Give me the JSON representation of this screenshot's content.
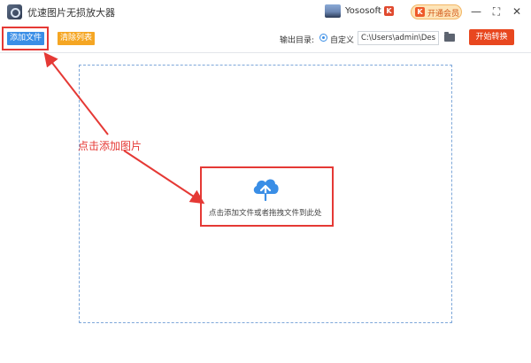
{
  "window": {
    "title": "优速图片无损放大器",
    "user_name": "Yososoft",
    "user_chevron": "⌵",
    "brand_badge": "K",
    "vip_icon": "K",
    "vip_label": "开通会员",
    "min_glyph": "—",
    "max_glyph": "⛶",
    "close_glyph": "✕"
  },
  "toolbar": {
    "add_file_label": "添加文件",
    "clear_list_label": "清除列表",
    "output_dir_label": "输出目录:",
    "custom_label": "自定义",
    "output_path_value": "C:\\Users\\admin\\Deskto",
    "start_label": "开始转换"
  },
  "drop_zone": {
    "hint": "点击添加文件或者拖拽文件到此处"
  },
  "annotation": {
    "text": "点击添加图片"
  },
  "colors": {
    "primary": "#3a8ee6",
    "accent_orange": "#f5a623",
    "start_red": "#e8471f",
    "annotation_red": "#e53935"
  },
  "icons": [
    "app-logo-icon",
    "user-avatar-icon",
    "brand-badge-icon",
    "vip-icon",
    "folder-icon",
    "cloud-upload-icon"
  ]
}
